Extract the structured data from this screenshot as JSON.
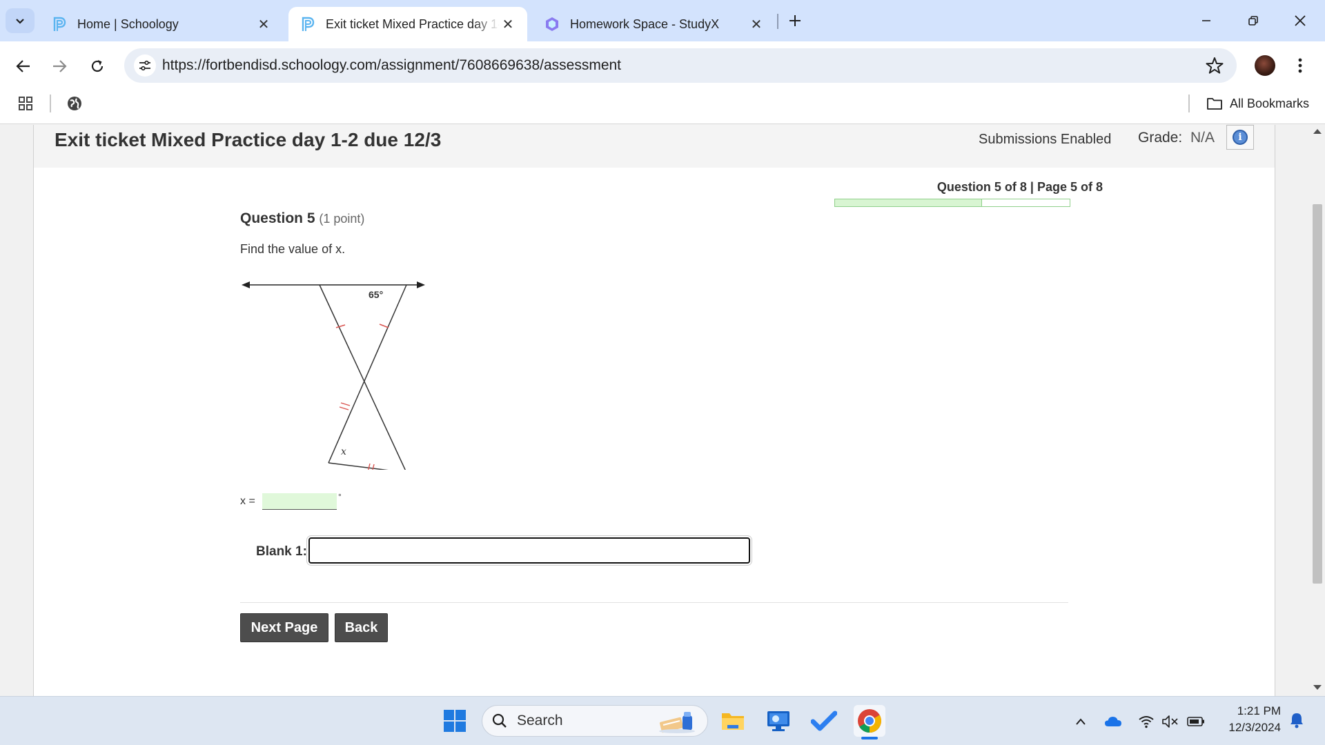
{
  "browser": {
    "tabs": [
      {
        "title": "Home | Schoology",
        "active": false
      },
      {
        "title": "Exit ticket Mixed Practice day 1-2 due 12/3",
        "active": true
      },
      {
        "title": "Homework Space - StudyX",
        "active": false
      }
    ],
    "url": "https://fortbendisd.schoology.com/assignment/7608669638/assessment",
    "bookmarks_label": "All Bookmarks"
  },
  "assignment": {
    "title": "Exit ticket Mixed Practice day 1-2 due 12/3",
    "submissions_status": "Submissions Enabled",
    "grade_label": "Grade:",
    "grade_value": "N/A"
  },
  "progress": {
    "text": "Question 5 of 8 | Page 5 of 8",
    "current": 5,
    "total": 8,
    "fraction": 0.625
  },
  "question": {
    "label": "Question 5",
    "points": "(1 point)",
    "prompt": "Find the value of x.",
    "figure": {
      "angle_label": "65°",
      "variable_label": "x"
    },
    "answer_prefix": "x =",
    "answer_suffix": "°",
    "answer_value": "",
    "blank_label": "Blank 1:",
    "blank_value": ""
  },
  "buttons": {
    "next": "Next Page",
    "back": "Back"
  },
  "taskbar": {
    "search_placeholder": "Search",
    "time": "1:21 PM",
    "date": "12/3/2024"
  },
  "colors": {
    "tabstrip": "#d3e3fd",
    "button_dark": "#4d4d4d",
    "progress_fill": "#d8f5d2",
    "answer_highlight": "#e0f8da"
  }
}
